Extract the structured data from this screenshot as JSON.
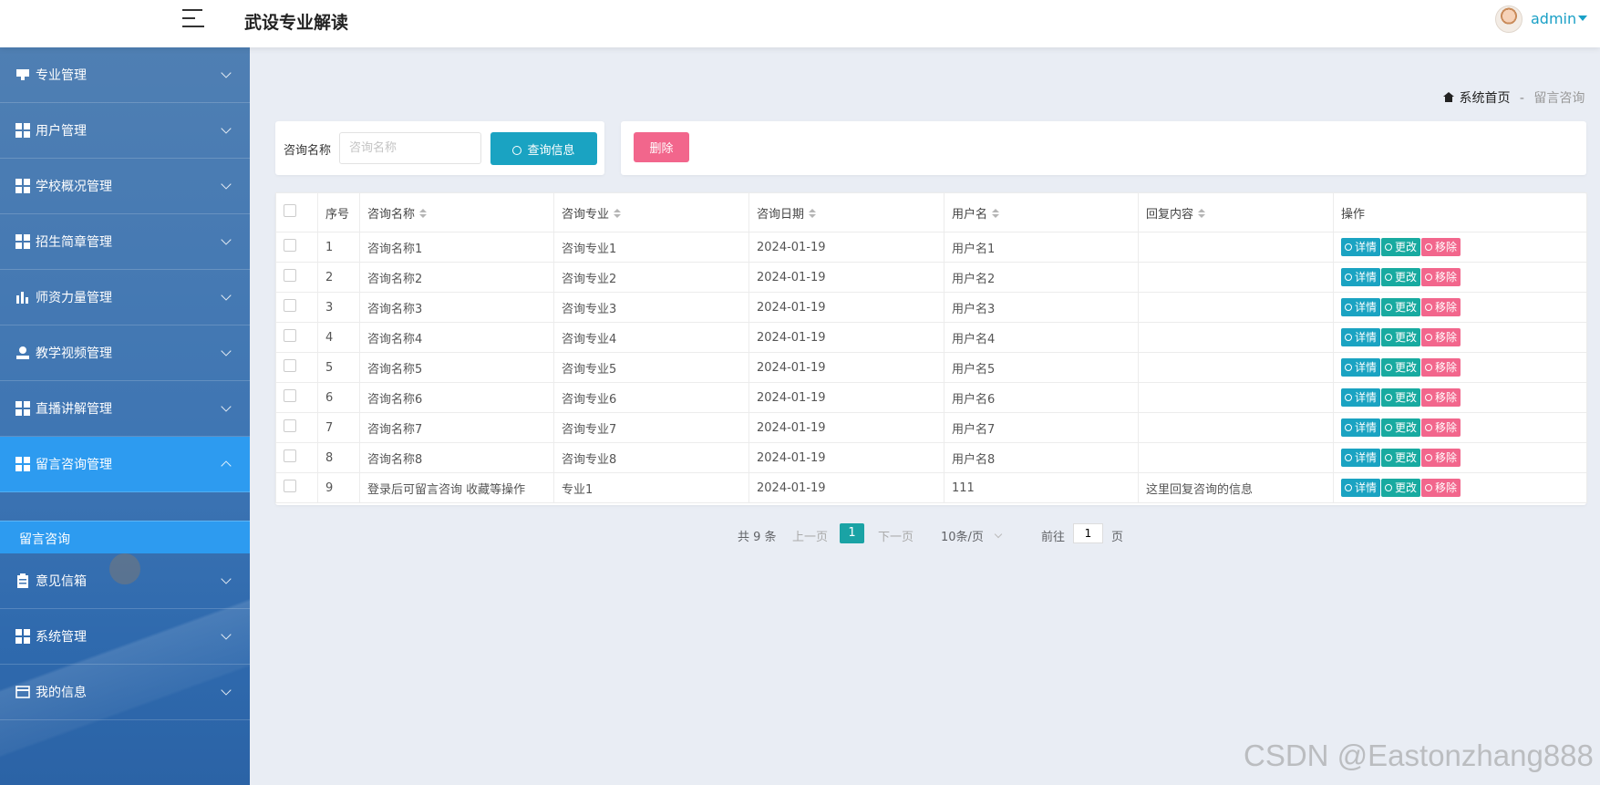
{
  "header": {
    "title": "武设专业解读",
    "user": "admin"
  },
  "sidebar": {
    "items": [
      {
        "label": "专业管理",
        "icon": "monitor-icon"
      },
      {
        "label": "用户管理",
        "icon": "grid-icon"
      },
      {
        "label": "学校概况管理",
        "icon": "grid-icon"
      },
      {
        "label": "招生简章管理",
        "icon": "grid-icon"
      },
      {
        "label": "师资力量管理",
        "icon": "bar-chart-icon"
      },
      {
        "label": "教学视频管理",
        "icon": "user-icon"
      },
      {
        "label": "直播讲解管理",
        "icon": "grid-icon"
      },
      {
        "label": "留言咨询管理",
        "icon": "grid-icon",
        "expanded": true
      },
      {
        "label": "意见信箱",
        "icon": "clipboard-icon"
      },
      {
        "label": "系统管理",
        "icon": "grid-icon"
      },
      {
        "label": "我的信息",
        "icon": "card-icon"
      }
    ],
    "submenu": {
      "label": "留言咨询"
    }
  },
  "breadcrumb": {
    "home": "系统首页",
    "separator": "-",
    "current": "留言咨询"
  },
  "search": {
    "label": "咨询名称",
    "placeholder": "咨询名称",
    "button": "查询信息"
  },
  "actions": {
    "delete": "删除"
  },
  "table": {
    "columns": [
      "序号",
      "咨询名称",
      "咨询专业",
      "咨询日期",
      "用户名",
      "回复内容",
      "操作"
    ],
    "rows": [
      {
        "no": "1",
        "name": "咨询名称1",
        "major": "咨询专业1",
        "date": "2024-01-19",
        "user": "用户名1",
        "reply": ""
      },
      {
        "no": "2",
        "name": "咨询名称2",
        "major": "咨询专业2",
        "date": "2024-01-19",
        "user": "用户名2",
        "reply": ""
      },
      {
        "no": "3",
        "name": "咨询名称3",
        "major": "咨询专业3",
        "date": "2024-01-19",
        "user": "用户名3",
        "reply": ""
      },
      {
        "no": "4",
        "name": "咨询名称4",
        "major": "咨询专业4",
        "date": "2024-01-19",
        "user": "用户名4",
        "reply": ""
      },
      {
        "no": "5",
        "name": "咨询名称5",
        "major": "咨询专业5",
        "date": "2024-01-19",
        "user": "用户名5",
        "reply": ""
      },
      {
        "no": "6",
        "name": "咨询名称6",
        "major": "咨询专业6",
        "date": "2024-01-19",
        "user": "用户名6",
        "reply": ""
      },
      {
        "no": "7",
        "name": "咨询名称7",
        "major": "咨询专业7",
        "date": "2024-01-19",
        "user": "用户名7",
        "reply": ""
      },
      {
        "no": "8",
        "name": "咨询名称8",
        "major": "咨询专业8",
        "date": "2024-01-19",
        "user": "用户名8",
        "reply": ""
      },
      {
        "no": "9",
        "name": "登录后可留言咨询 收藏等操作",
        "major": "专业1",
        "date": "2024-01-19",
        "user": "111",
        "reply": "这里回复咨询的信息"
      }
    ],
    "ops": {
      "detail": "详情",
      "edit": "更改",
      "remove": "移除"
    }
  },
  "pagination": {
    "total": "共 9 条",
    "prev": "上一页",
    "current": "1",
    "next": "下一页",
    "page_size": "10条/页",
    "goto_label": "前往",
    "goto_value": "1",
    "page_suffix": "页"
  },
  "watermark": "CSDN @Eastonzhang888",
  "colors": {
    "primary": "#1aa3c2",
    "danger": "#f2668c",
    "sidebar_active": "#2d9bf0"
  }
}
